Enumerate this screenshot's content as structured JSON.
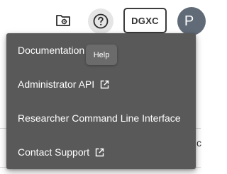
{
  "topbar": {
    "cluster_label": "DGXC",
    "avatar_initial": "P"
  },
  "tooltip": {
    "text": "Help"
  },
  "menu": {
    "items": [
      {
        "label": "Documentation",
        "icon": "external-link-icon"
      },
      {
        "label": "Administrator API",
        "icon": "external-link-icon"
      },
      {
        "label": "Researcher Command Line Interface"
      },
      {
        "label": "Contact Support",
        "icon": "external-link-icon"
      }
    ]
  },
  "background": {
    "partial_text": "c"
  }
}
